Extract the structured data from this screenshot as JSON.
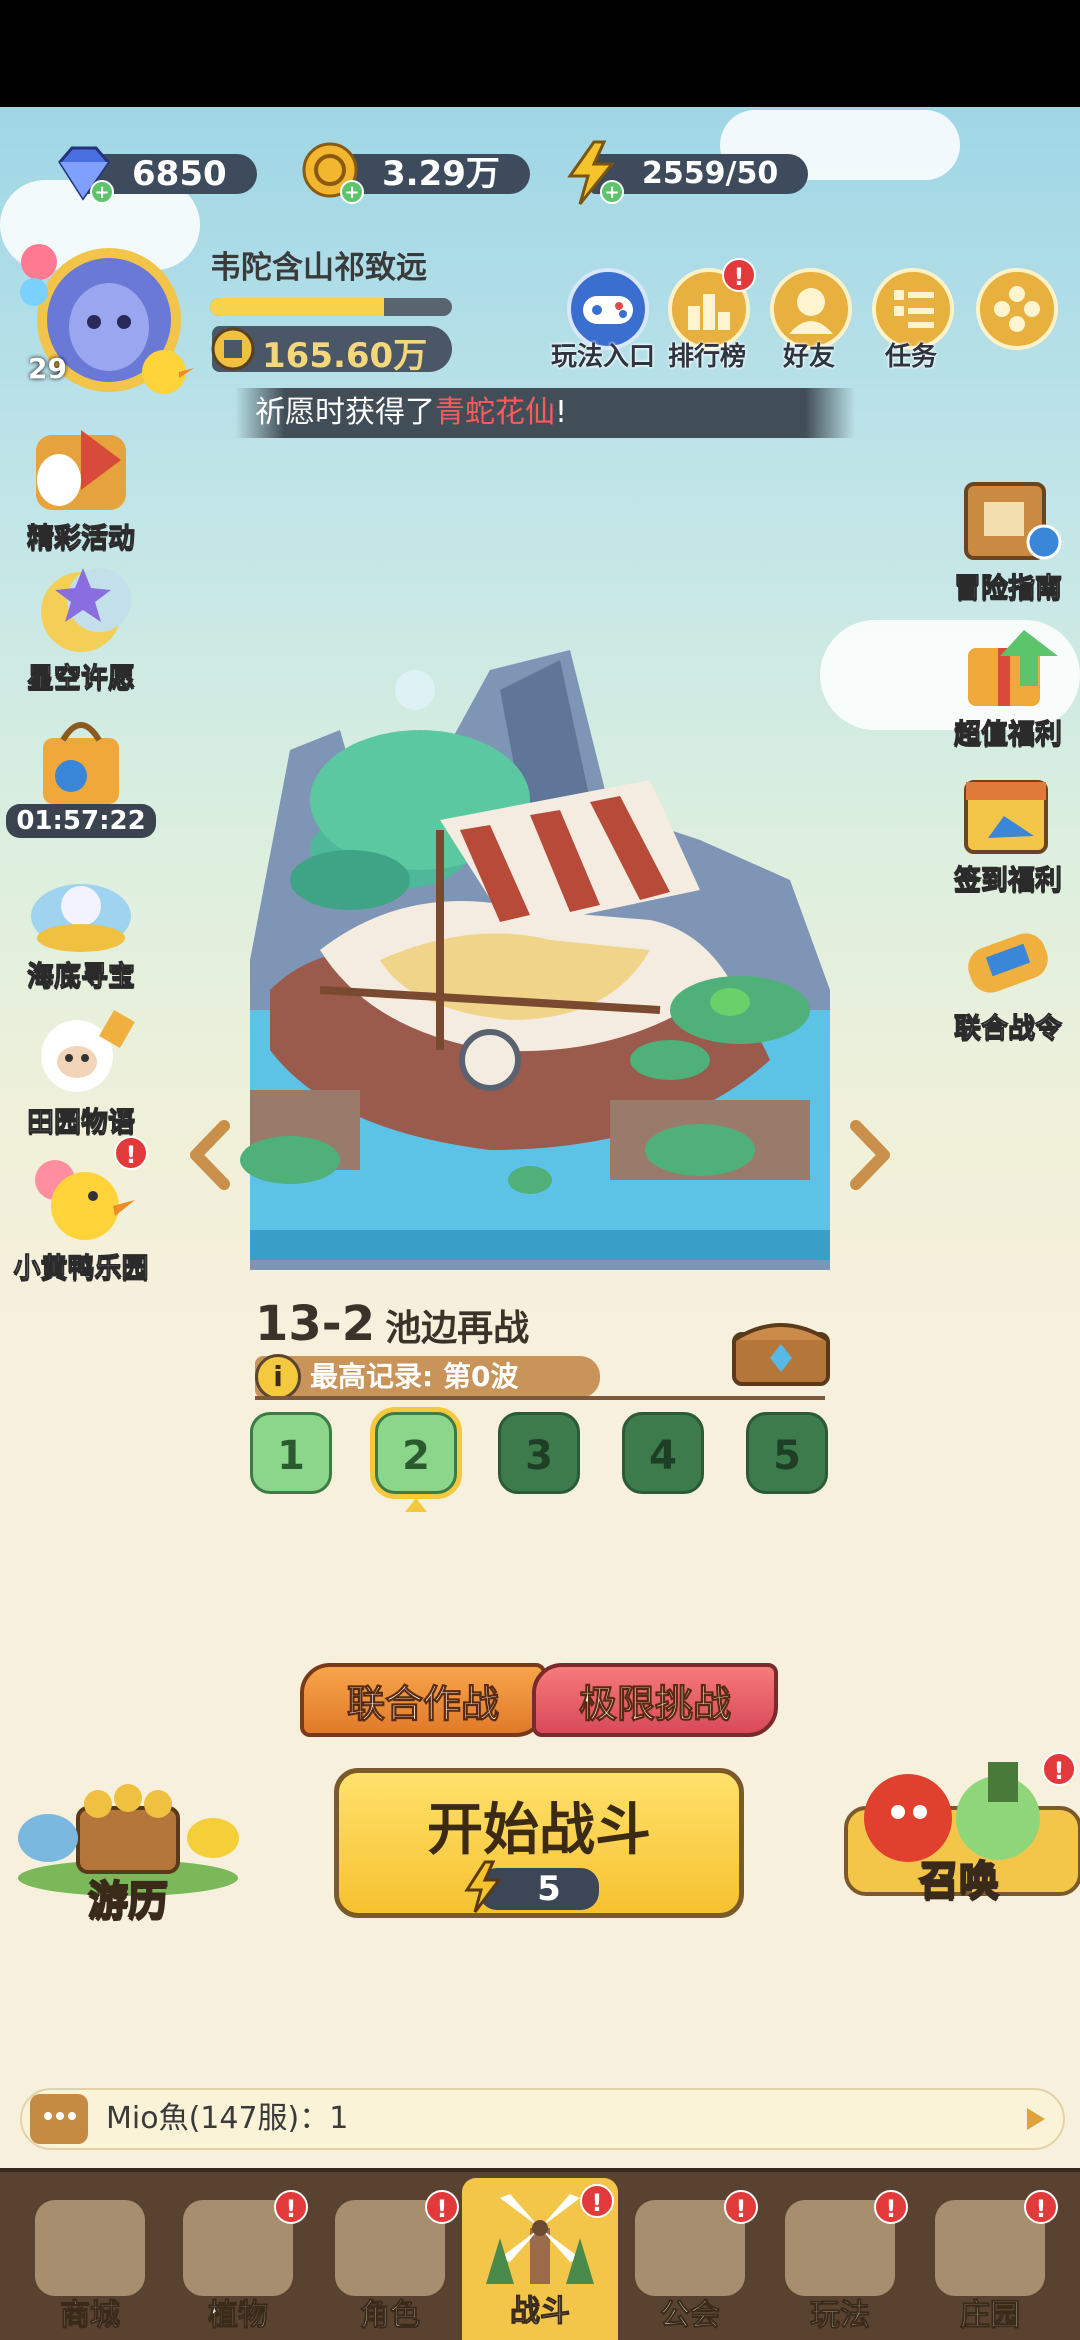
{
  "resources": {
    "diamonds": "6850",
    "coins": "3.29万",
    "energy": "2559/50"
  },
  "player": {
    "name": "韦陀含山祁致远",
    "level": "29",
    "xp_progress": 0.72,
    "power": "165.60万"
  },
  "top_buttons": [
    {
      "label": "玩法入口"
    },
    {
      "label": "排行榜",
      "badge": "!"
    },
    {
      "label": "好友"
    },
    {
      "label": "任务"
    }
  ],
  "ticker": {
    "prefix": "祈愿时获得了",
    "highlight": "青蛇花仙",
    "suffix": "!"
  },
  "left_menu": [
    {
      "label": "精彩活动"
    },
    {
      "label": "星空许愿"
    },
    {
      "label": "01:57:22"
    },
    {
      "label": "海底寻宝"
    },
    {
      "label": "田园物语"
    },
    {
      "label": "小黄鸭乐园",
      "badge": "!"
    }
  ],
  "right_menu": [
    {
      "label": "冒险指南"
    },
    {
      "label": "超值福利"
    },
    {
      "label": "签到福利"
    },
    {
      "label": "联合战令"
    }
  ],
  "stage": {
    "number": "13-2",
    "name": "池边再战",
    "record": "最高记录: 第0波",
    "waves": [
      "1",
      "2",
      "3",
      "4",
      "5"
    ],
    "current_wave": "2"
  },
  "modes": {
    "coop": "联合作战",
    "extreme": "极限挑战"
  },
  "start": {
    "label": "开始战斗",
    "cost": "5"
  },
  "side_actions": {
    "travel": "游历",
    "summon": "召唤",
    "summon_badge": "!"
  },
  "chat": {
    "text": "Mio魚(147服)：1"
  },
  "nav": [
    {
      "label": "商城"
    },
    {
      "label": "植物",
      "badge": "!"
    },
    {
      "label": "角色",
      "badge": "!"
    },
    {
      "label": "战斗",
      "badge": "!"
    },
    {
      "label": "公会",
      "badge": "!"
    },
    {
      "label": "玩法",
      "badge": "!"
    },
    {
      "label": "庄园",
      "badge": "!"
    }
  ],
  "colors": {
    "accent": "#f5c93d",
    "badge": "#e23a3a",
    "ticker_highlight": "#ff5a5a"
  }
}
